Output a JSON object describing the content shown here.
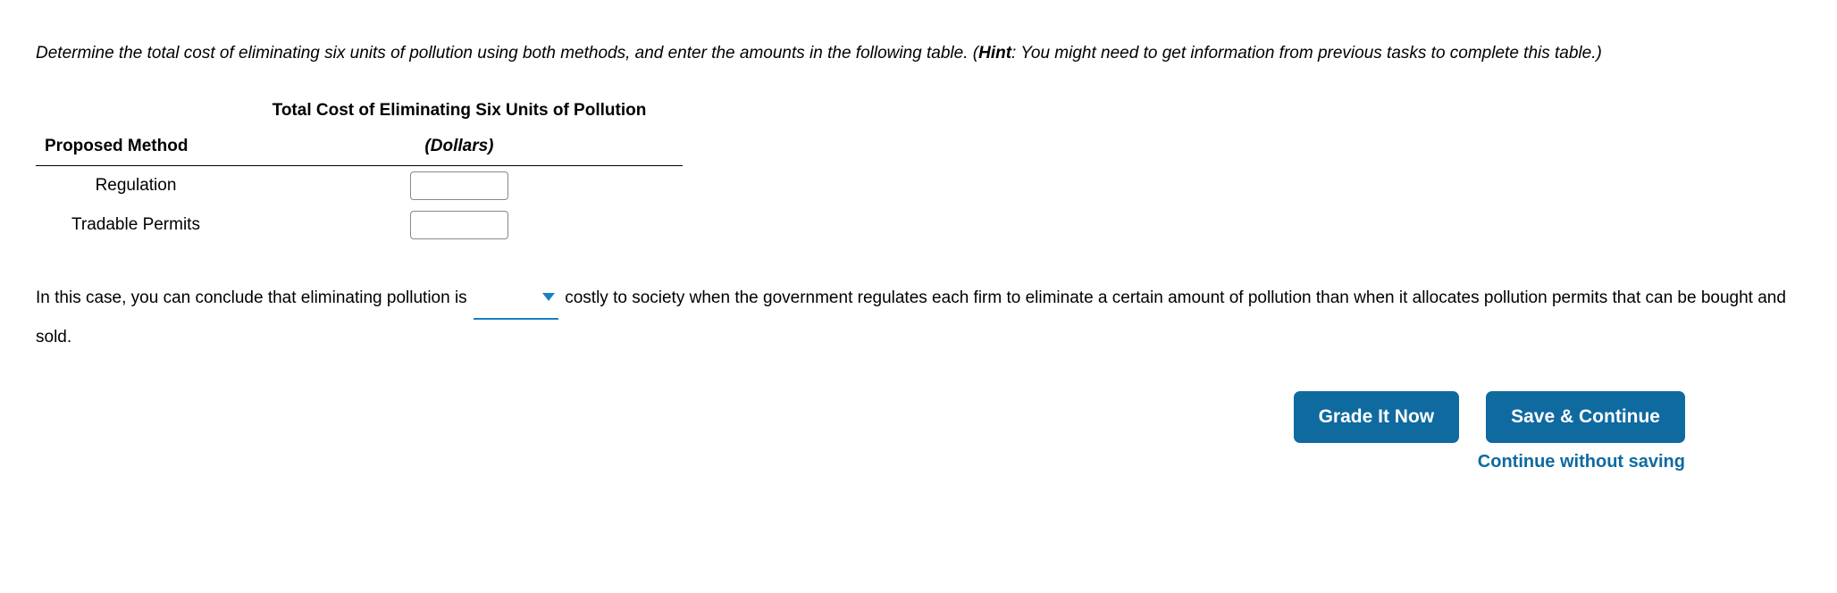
{
  "instructions": {
    "text_before_hint": "Determine the total cost of eliminating six units of pollution using both methods, and enter the amounts in the following table. (",
    "hint_label": "Hint",
    "text_after_hint": ": You might need to get information from previous tasks to complete this table.)"
  },
  "table": {
    "col_method": "Proposed Method",
    "col_cost_line1": "Total Cost of Eliminating Six Units of Pollution",
    "col_cost_line2": "(Dollars)",
    "rows": [
      {
        "label": "Regulation",
        "value": ""
      },
      {
        "label": "Tradable Permits",
        "value": ""
      }
    ]
  },
  "conclusion": {
    "before_blank": "In this case, you can conclude that eliminating pollution is ",
    "dropdown_value": "",
    "after_blank": " costly to society when the government regulates each firm to eliminate a certain amount of pollution than when it allocates pollution permits that can be bought and sold."
  },
  "buttons": {
    "grade": "Grade It Now",
    "save": "Save & Continue",
    "continue_link": "Continue without saving"
  }
}
